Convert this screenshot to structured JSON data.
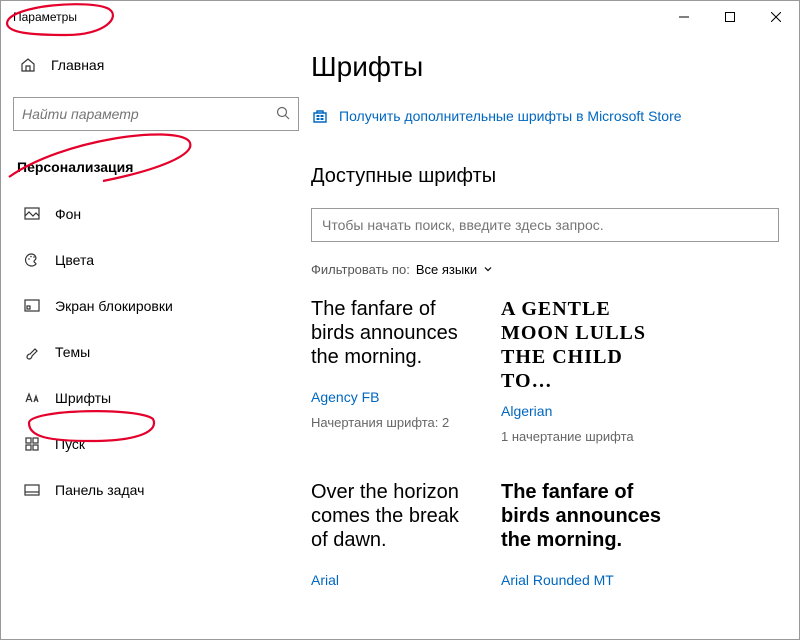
{
  "window": {
    "title": "Параметры"
  },
  "sidebar": {
    "home_label": "Главная",
    "search_placeholder": "Найти параметр",
    "section_label": "Персонализация",
    "items": [
      {
        "label": "Фон"
      },
      {
        "label": "Цвета"
      },
      {
        "label": "Экран блокировки"
      },
      {
        "label": "Темы"
      },
      {
        "label": "Шрифты"
      },
      {
        "label": "Пуск"
      },
      {
        "label": "Панель задач"
      }
    ]
  },
  "main": {
    "title": "Шрифты",
    "store_link": "Получить дополнительные шрифты в Microsoft Store",
    "available_title": "Доступные шрифты",
    "font_search_placeholder": "Чтобы начать поиск, введите здесь запрос.",
    "filter_label": "Фильтровать по:",
    "filter_value": "Все языки",
    "fonts": [
      {
        "preview": "The fanfare of birds announces the morning.",
        "name": "Agency FB",
        "faces": "Начертания шрифта: 2",
        "preview_class": "preview-agencyfb"
      },
      {
        "preview": "A gentle moon lulls the child to…",
        "name": "Algerian",
        "faces": "1 начертание шрифта",
        "preview_class": "preview-algerian"
      },
      {
        "preview": "Over the horizon comes the break of dawn.",
        "name": "Arial",
        "faces": "",
        "preview_class": "preview-arial"
      },
      {
        "preview": "The fanfare of birds announces the morning.",
        "name": "Arial Rounded MT",
        "faces": "",
        "preview_class": "preview-arialrounded"
      }
    ]
  }
}
